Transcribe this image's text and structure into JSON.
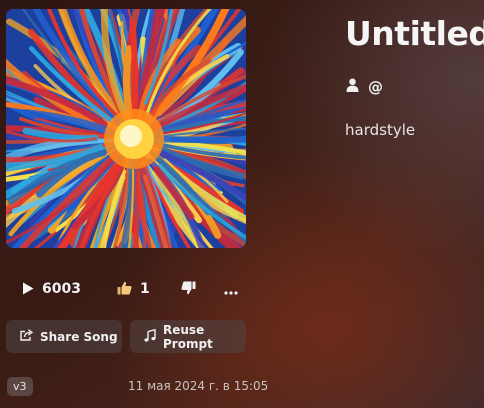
{
  "song": {
    "title": "Untitled",
    "author_handle": "@",
    "style": "hardstyle",
    "play_count": "6003",
    "like_count": "1",
    "version": "v3",
    "created": "11 мая 2024 г. в 15:05"
  },
  "actions": {
    "share_label": "Share Song",
    "reuse_label": "Reuse Prompt"
  },
  "icons": {
    "play": "play-icon",
    "like": "thumbs-up-icon",
    "dislike": "thumbs-down-icon",
    "more": "more-icon",
    "author": "user-icon",
    "share": "share-icon",
    "reuse": "music-note-icon"
  },
  "colors": {
    "background": "#3a1c15",
    "button_bg": "#4d4444",
    "like_icon": "#f0c070"
  }
}
